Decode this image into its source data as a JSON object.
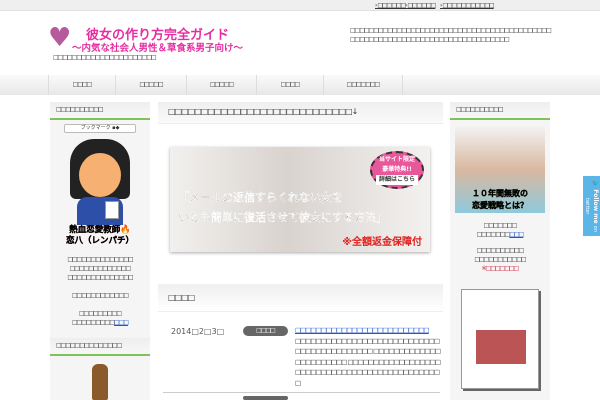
{
  "topbar": {
    "links": [
      "□□□□□□",
      "□□□□□□",
      "□□□□□□□□□□□"
    ]
  },
  "header": {
    "logo_title": "彼女の作り方完全ガイド",
    "logo_subtitle": "～内気な社会人男性＆草食系男子向け～",
    "tagline": "□□□□□□□□□□□□□□□□□□□□□□",
    "description": "□□□□□□□□□□□□□□□□□□□□□□□□□□□□□□□□□□□□□□□□□□□□□□□□□□□□□□□□□□□□□□□□□□□□□□□□□□□□□"
  },
  "nav": {
    "items": [
      "□□□□",
      "□□□□□",
      "□□□□□",
      "□□□□",
      "□□□□□□□"
    ]
  },
  "left_sidebar": {
    "profile_heading": "□□□□□□□□□□",
    "bookmark_label": "ブックマーク",
    "profile_name1": "熱血恋愛教師",
    "profile_name2": "恋八（レンパチ）",
    "lines": [
      "□□□□□□□□□□□□□□",
      "□□□□□□□□□□□□□",
      "□□□□□□□□□□□□□□",
      "□□□□□□□□□□□□"
    ],
    "line5": "□□□□□□□□□",
    "line6": "□□□□□□□□□",
    "line6_link": "□□□",
    "second_heading": "□□□□□□□□□□□□□□"
  },
  "main": {
    "heading": "□□□□□□□□□□□□□□□□□□□□□□□□□□□□↓",
    "banner": {
      "line1": "「メールの返信すらくれない女を",
      "line2": "いとも簡単に復活させて彼女にする方法」",
      "guarantee": "※全額返金保障付",
      "badge1": "当サイト限定",
      "badge2": "豪華特典!!",
      "badge3": "詳細はこちら"
    },
    "news_heading": "□□□□",
    "news": [
      {
        "date": "2014□2□3□",
        "category": "□□□□",
        "title": "□□□□□□□□□□□□□□□□□□□□□□□□□□",
        "excerpt": "□□□□□□□□□□□□□□□□□□□□□□□□□□□□□□□□□□□□□□□□□□□ □□□□□□□□□□□□□□□□□□□□□□□ □□□□□□□□□□□□□□□□□□□□□□□□□□□□□□□□□□□□□□□□□□□□□□□"
      }
    ]
  },
  "right_sidebar": {
    "heading": "□□□□□□□□□□",
    "ad_line1": "１０年間無敗の",
    "ad_line2": "恋愛戦略とは？",
    "text1": "□□□□□□□",
    "text2": "□□□□□□□",
    "text2_link": "□□□",
    "text3": "□□□□□□□□□□",
    "text4": "□□□□□□□□□□□",
    "text5": "※□□□□□□□"
  },
  "twitter": {
    "line1": "Follow me",
    "line2": "on twitter"
  }
}
